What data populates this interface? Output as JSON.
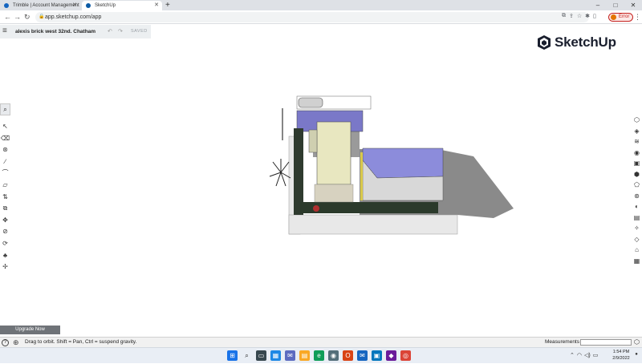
{
  "browser": {
    "tabs": [
      {
        "title": "Trimble | Account Management",
        "favicon_color": "#1565c0"
      },
      {
        "title": "SketchUp",
        "favicon_color": "#0b5aa5"
      }
    ],
    "url": "app.sketchup.com/app",
    "profile_status": "Error",
    "icons": {
      "back": "arrow-left",
      "forward": "arrow-right",
      "reload": "refresh",
      "newtab": "plus"
    }
  },
  "app": {
    "model_name": "alexis brick west 32nd. Chatham",
    "save_status": "SAVED",
    "brand": "SketchUp",
    "brand_color": "#1a1f2e",
    "upgrade_label": "Upgrade Now",
    "status_hint": "Drag to orbit. Shift = Pan, Ctrl = suspend gravity.",
    "measurements_label": "Measurements",
    "measurements_value": ""
  },
  "left_tools": [
    "select",
    "eraser",
    "paint-bucket",
    "line",
    "arc",
    "rectangle",
    "push-pull",
    "move",
    "rotate",
    "tape-measure",
    "orbit",
    "walk",
    "pan"
  ],
  "right_tools": [
    "entity-info",
    "instructor",
    "components",
    "materials",
    "styles",
    "layers",
    "outliner",
    "scenes",
    "shadows",
    "display",
    "solar-north",
    "tags",
    "3d-warehouse",
    "extensions"
  ],
  "taskbar": {
    "apps": [
      "start",
      "search",
      "task-view",
      "widgets",
      "chat",
      "explorer",
      "edge",
      "camera",
      "office",
      "mail",
      "store",
      "photos",
      "chrome"
    ],
    "clock_time": "1:54 PM",
    "clock_date": "2/9/2022"
  }
}
